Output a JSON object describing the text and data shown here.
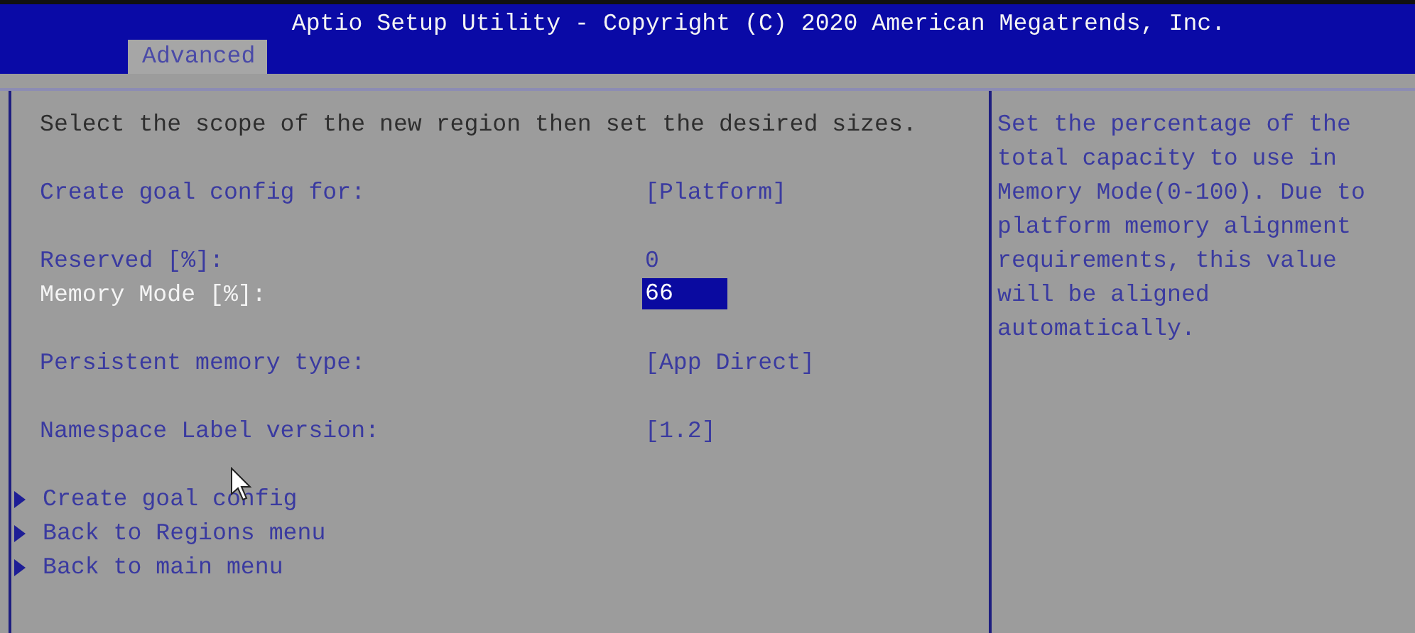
{
  "header": {
    "title": "Aptio Setup Utility - Copyright (C) 2020 American Megatrends, Inc."
  },
  "tabs": [
    {
      "label": "Advanced",
      "selected": true
    }
  ],
  "rows": [
    {
      "kind": "text",
      "text": "Select the scope of the new region then set the desired sizes."
    },
    {
      "kind": "blank"
    },
    {
      "kind": "setting",
      "label": "Create goal config for:",
      "value": "[Platform]",
      "selected": false
    },
    {
      "kind": "blank"
    },
    {
      "kind": "setting",
      "label": "Reserved [%]:",
      "value": "0",
      "selected": false
    },
    {
      "kind": "setting",
      "label": "Memory Mode [%]:",
      "value": "66",
      "selected": true
    },
    {
      "kind": "blank"
    },
    {
      "kind": "setting",
      "label": "Persistent memory type:",
      "value": "[App Direct]",
      "selected": false
    },
    {
      "kind": "blank"
    },
    {
      "kind": "setting",
      "label": "Namespace Label version:",
      "value": "[1.2]",
      "selected": false
    },
    {
      "kind": "blank"
    },
    {
      "kind": "submenu",
      "label": "Create goal config",
      "selected": false
    },
    {
      "kind": "submenu",
      "label": "Back to Regions menu",
      "selected": false
    },
    {
      "kind": "submenu",
      "label": "Back to main menu",
      "selected": false
    }
  ],
  "help": {
    "text": "Set the percentage of the total capacity to use in Memory Mode(0-100). Due to platform memory alignment requirements, this value will be aligned automatically."
  }
}
